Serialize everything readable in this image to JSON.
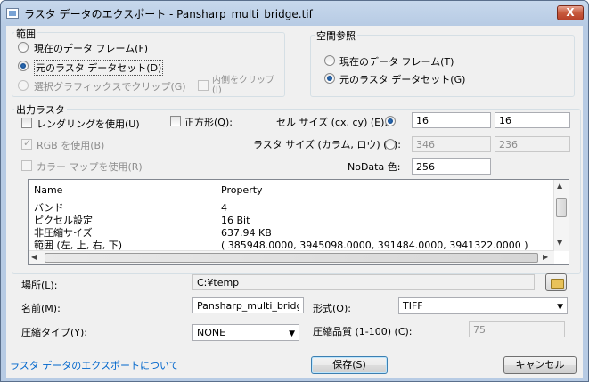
{
  "window": {
    "title": "ラスタ データのエクスポート - Pansharp_multi_bridge.tif",
    "close": "X"
  },
  "extent": {
    "label": "範囲",
    "options": [
      {
        "label": "現在のデータ フレーム(F)",
        "selected": false,
        "enabled": true
      },
      {
        "label": "元のラスタ データセット(D)",
        "selected": true,
        "enabled": true
      },
      {
        "label": "選択グラフィックスでクリップ(G)",
        "selected": false,
        "enabled": false
      }
    ],
    "clip_inside": {
      "label": "内側をクリップ",
      "label2": "(I)",
      "checked": false,
      "enabled": false
    }
  },
  "spatial_ref": {
    "label": "空間参照",
    "options": [
      {
        "label": "現在のデータ フレーム(T)",
        "selected": false
      },
      {
        "label": "元のラスタ データセット(G)",
        "selected": true
      }
    ]
  },
  "output": {
    "label": "出力ラスタ",
    "use_renderer": {
      "label": "レンダリングを使用(U)",
      "checked": false
    },
    "square": {
      "label": "正方形(Q):",
      "checked": false
    },
    "use_rgb": {
      "label": "RGB を使用(B)",
      "checked": true,
      "enabled": false
    },
    "use_colormap": {
      "label": "カラー マップを使用(R)",
      "checked": false,
      "enabled": false
    },
    "cell_size": {
      "label": "セル サイズ (cx, cy)  (E):",
      "selected": true,
      "cx": "16",
      "cy": "16"
    },
    "raster_size": {
      "label": "ラスタ サイズ (カラム, ロウ)  (Z):",
      "selected": false,
      "cols": "346",
      "rows": "236"
    },
    "nodata": {
      "label": "NoData 色:",
      "value": "256"
    }
  },
  "properties": {
    "columns": [
      "Name",
      "Property"
    ],
    "rows": [
      [
        "バンド",
        "4"
      ],
      [
        "ピクセル設定",
        "16 Bit"
      ],
      [
        "非圧縮サイズ",
        "637.94 KB"
      ],
      [
        "範囲 (左, 上, 右, 下)",
        "( 385948.0000, 3945098.0000, 391484.0000, 3941322.0000 )"
      ]
    ]
  },
  "location": {
    "label": "場所(L):",
    "value": "C:¥temp"
  },
  "name": {
    "label": "名前(M):",
    "value": "Pansharp_multi_bridge"
  },
  "format": {
    "label": "形式(O):",
    "value": "TIFF"
  },
  "compression": {
    "label": "圧縮タイプ(Y):",
    "value": "NONE"
  },
  "quality": {
    "label": "圧縮品質 (1-100)  (C):",
    "value": "75"
  },
  "footer": {
    "help_link": "ラスタ データのエクスポートについて",
    "save": "保存(S)",
    "cancel": "キャンセル"
  },
  "icons": {
    "folder": "folder-open-icon"
  }
}
